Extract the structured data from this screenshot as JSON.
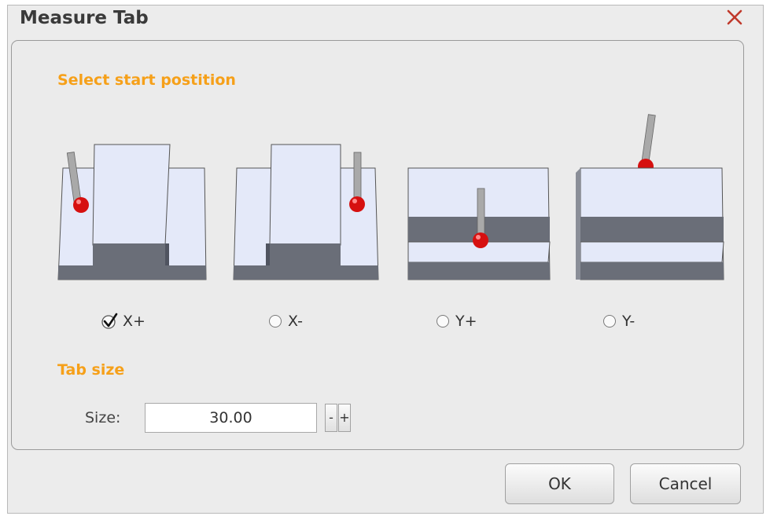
{
  "dialog": {
    "title": "Measure Tab",
    "close_icon": "close-x-icon"
  },
  "start_position": {
    "heading": "Select start postition",
    "options": [
      {
        "label": "X+",
        "selected": true
      },
      {
        "label": "X-",
        "selected": false
      },
      {
        "label": "Y+",
        "selected": false
      },
      {
        "label": "Y-",
        "selected": false
      }
    ]
  },
  "tab_size": {
    "heading": "Tab size",
    "size_label": "Size:",
    "size_value": "30.00",
    "decrement_label": "-",
    "increment_label": "+"
  },
  "buttons": {
    "ok_label": "OK",
    "cancel_label": "Cancel"
  },
  "colors": {
    "section_heading": "#f6a019",
    "close_icon": "#c0392b",
    "block_face": "#e3e8f8",
    "block_side": "#6a6e78",
    "probe_ball": "#d61010"
  }
}
